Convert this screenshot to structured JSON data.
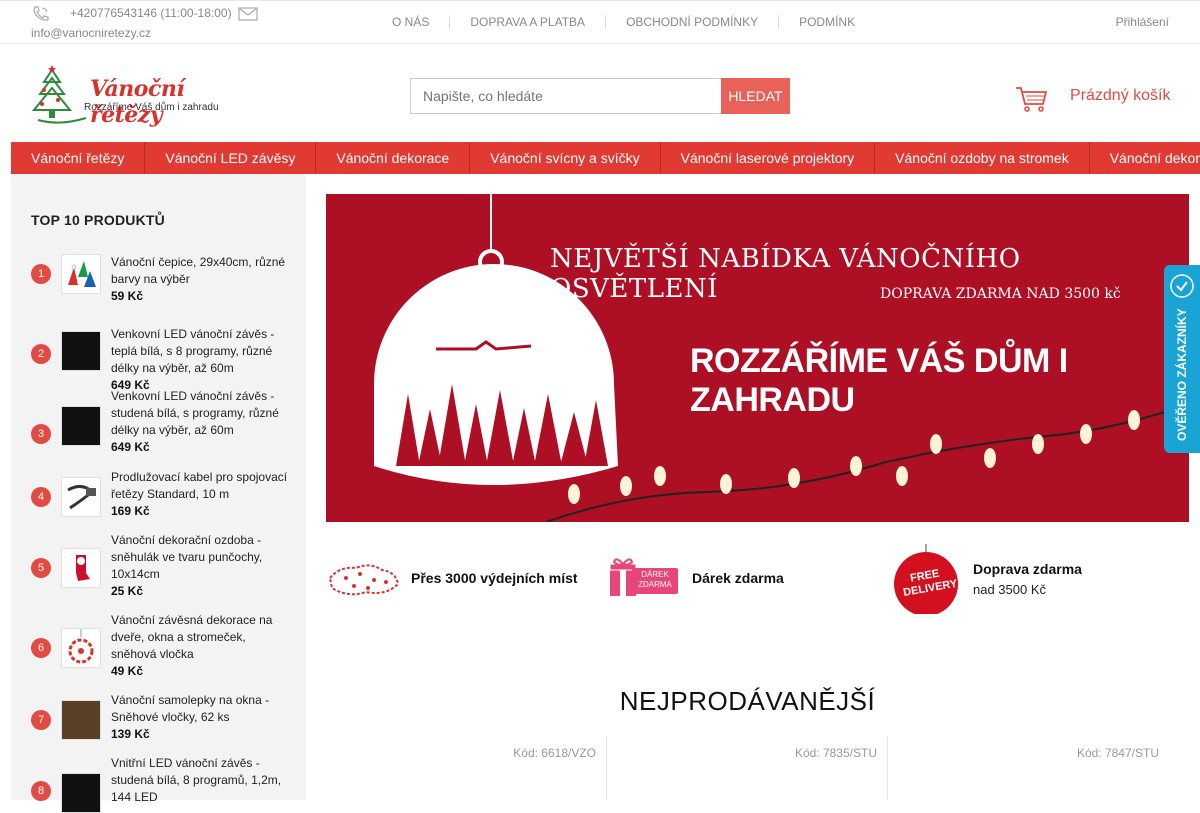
{
  "topbar": {
    "phone": "+420776543146 (11:00-18:00)",
    "email": "info@vanocniretezy.cz",
    "links": [
      "O NÁS",
      "DOPRAVA A PLATBA",
      "OBCHODNÍ PODMÍNKY",
      "PODMÍNK"
    ],
    "login": "Přihlášení"
  },
  "logo": {
    "title": "Vánoční řetězy",
    "subtitle": "Rozzáříme Váš dům i zahradu"
  },
  "search": {
    "placeholder": "Napište, co hledáte",
    "button": "HLEDAT"
  },
  "cart": {
    "label": "Prázdný košík"
  },
  "categories": [
    "Vánoční řetězy",
    "Vánoční LED závěsy",
    "Vánoční dekorace",
    "Vánoční svícny a svíčky",
    "Vánoční laserové projektory",
    "Vánoční ozdoby na stromek",
    "Vánoční dekorace - VY"
  ],
  "sidebar": {
    "title": "TOP 10 PRODUKTŮ",
    "items": [
      {
        "num": "1",
        "name": "Vánoční čepice, 29x40cm, různé barvy na výběr",
        "price": "59 Kč"
      },
      {
        "num": "2",
        "name": "Venkovní LED vánoční závěs - teplá bílá, s 8 programy, různé délky na výběr, až 60m",
        "price": "649 Kč"
      },
      {
        "num": "3",
        "name": "Venkovní LED vánoční závěs - studená bílá, s programy, různé délky na výběr, až 60m",
        "price": "649 Kč"
      },
      {
        "num": "4",
        "name": "Prodlužovací kabel pro spojovací řetězy Standard, 10 m",
        "price": "169 Kč"
      },
      {
        "num": "5",
        "name": "Vánoční dekorační ozdoba - sněhulák ve tvaru punčochy, 10x14cm",
        "price": "25 Kč"
      },
      {
        "num": "6",
        "name": "Vánoční závěsná dekorace na dveře, okna a stromeček, sněhová vločka",
        "price": "49 Kč"
      },
      {
        "num": "7",
        "name": "Vánoční samolepky na okna - Sněhové vločky, 62 ks",
        "price": "139 Kč"
      },
      {
        "num": "8",
        "name": "Vnitřní LED vánoční závěs - studená bílá, 8 programů, 1,2m, 144 LED",
        "price": ""
      }
    ]
  },
  "banner": {
    "line1": "NEJVĚTŠÍ NABÍDKA VÁNOČNÍHO OSVĚTLENÍ",
    "line2": "DOPRAVA ZDARMA NAD 3500 kč",
    "line3": "ROZZÁŘÍME VÁŠ DŮM I ZAHRADU"
  },
  "features": [
    {
      "title": "Přes 3000 výdejních míst",
      "sub": ""
    },
    {
      "title": "Dárek zdarma",
      "sub": "",
      "badge": "DÁREK ZDARMA"
    },
    {
      "title": "Doprava zdarma",
      "sub": "nad 3500 Kč",
      "badge": "FREE DELIVERY"
    }
  ],
  "bestsellers": {
    "title": "NEJPRODÁVANĚJŠÍ",
    "codes": [
      "Kód: 6618/VZO",
      "Kód: 7835/STU",
      "Kód: 7847/STU"
    ]
  },
  "verified_badge": "OVĚŘENO ZÁKAZNÍKY",
  "colors": {
    "accent": "#e03a33",
    "banner": "#ad0f24",
    "badge": "#1aa4d6"
  }
}
